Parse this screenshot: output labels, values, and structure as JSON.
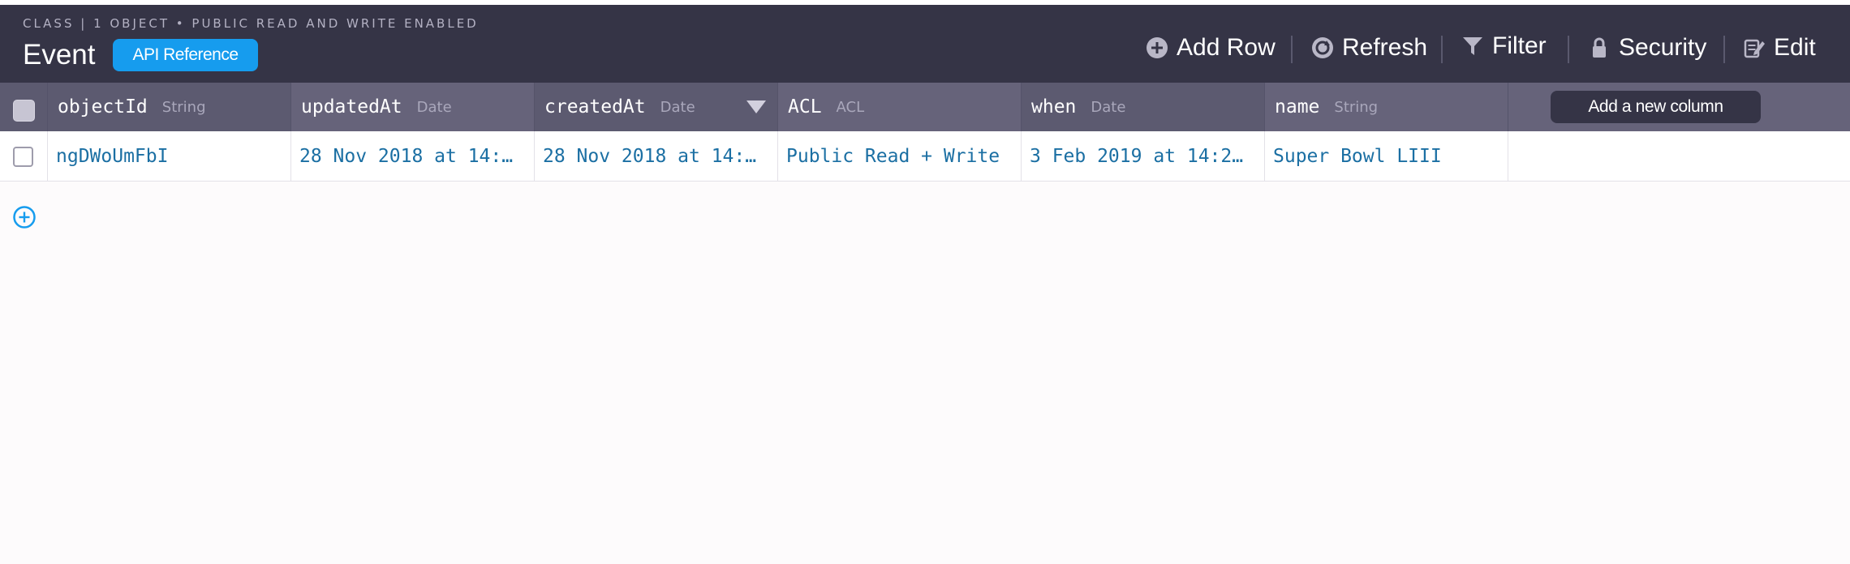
{
  "header": {
    "subtitle": "CLASS | 1 OBJECT • PUBLIC READ AND WRITE ENABLED",
    "class_name": "Event",
    "api_reference_label": "API Reference"
  },
  "toolbar": {
    "add_row": {
      "label": "Add Row",
      "icon": "plus-circle-icon"
    },
    "refresh": {
      "label": "Refresh",
      "icon": "refresh-icon"
    },
    "filter": {
      "label": "Filter",
      "icon": "filter-icon"
    },
    "security": {
      "label": "Security",
      "icon": "lock-icon"
    },
    "edit": {
      "label": "Edit",
      "icon": "edit-icon"
    }
  },
  "columns": [
    {
      "name": "objectId",
      "type": "String"
    },
    {
      "name": "updatedAt",
      "type": "Date"
    },
    {
      "name": "createdAt",
      "type": "Date",
      "sorted": "descending"
    },
    {
      "name": "ACL",
      "type": "ACL"
    },
    {
      "name": "when",
      "type": "Date"
    },
    {
      "name": "name",
      "type": "String"
    }
  ],
  "add_column_label": "Add a new column",
  "rows": [
    {
      "objectId": "ngDWoUmFbI",
      "updatedAt": "28 Nov 2018 at 14:…",
      "createdAt": "28 Nov 2018 at 14:…",
      "ACL": "Public Read + Write",
      "when": "3 Feb 2019 at 14:2…",
      "name": "Super Bowl LIII"
    }
  ],
  "colors": {
    "header_bg": "#353446",
    "column_header_bg": "#66637a",
    "accent": "#169cee",
    "cell_text": "#1b6fa3"
  }
}
